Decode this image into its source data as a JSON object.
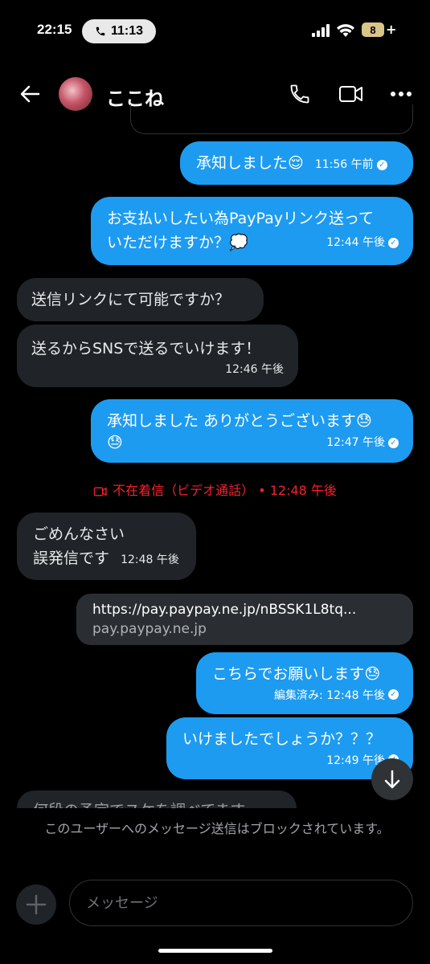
{
  "status_bar": {
    "time": "22:15",
    "call_time": "11:13",
    "battery": "8"
  },
  "header": {
    "contact_name": "ここね"
  },
  "messages": [
    {
      "text": "承知しました😌",
      "time": "11:56 午前"
    },
    {
      "text1": "お支払いしたい為PayPayリンク送って",
      "text2": "いただけますか？💭",
      "time": "12:44 午後"
    },
    {
      "text": "送信リンクにて可能ですか？"
    },
    {
      "text": "送るからSNSで送るでいけます！",
      "time": "12:46 午後"
    },
    {
      "text1": "承知しました ありがとうございます😓",
      "text2": "😓",
      "time": "12:47 午後"
    },
    {
      "text1": "ごめんなさい",
      "text2": "誤発信です",
      "time": "12:48 午後"
    },
    {
      "link_title": "https://pay.paypay.ne.jp/nBSSK1L8tq...",
      "link_domain": "pay.paypay.ne.jp"
    },
    {
      "text": "こちらでお願いします😓",
      "time": "編集済み: 12:48 午後"
    },
    {
      "text": "いけましたでしょうか？？？",
      "time": "12:49 午後"
    },
    {
      "text": "何段の予定でスケを調べてます"
    }
  ],
  "missed_call": {
    "label": "不在着信（ビデオ通話）",
    "time": "• 12:48 午後"
  },
  "blocked_notice": "このユーザーへのメッセージ送信はブロックされています。",
  "composer": {
    "placeholder": "メッセージ"
  },
  "colors": {
    "bubble_out": "#1d9bf0",
    "bubble_in": "#202327",
    "missed": "#f4212e",
    "background": "#000000"
  }
}
